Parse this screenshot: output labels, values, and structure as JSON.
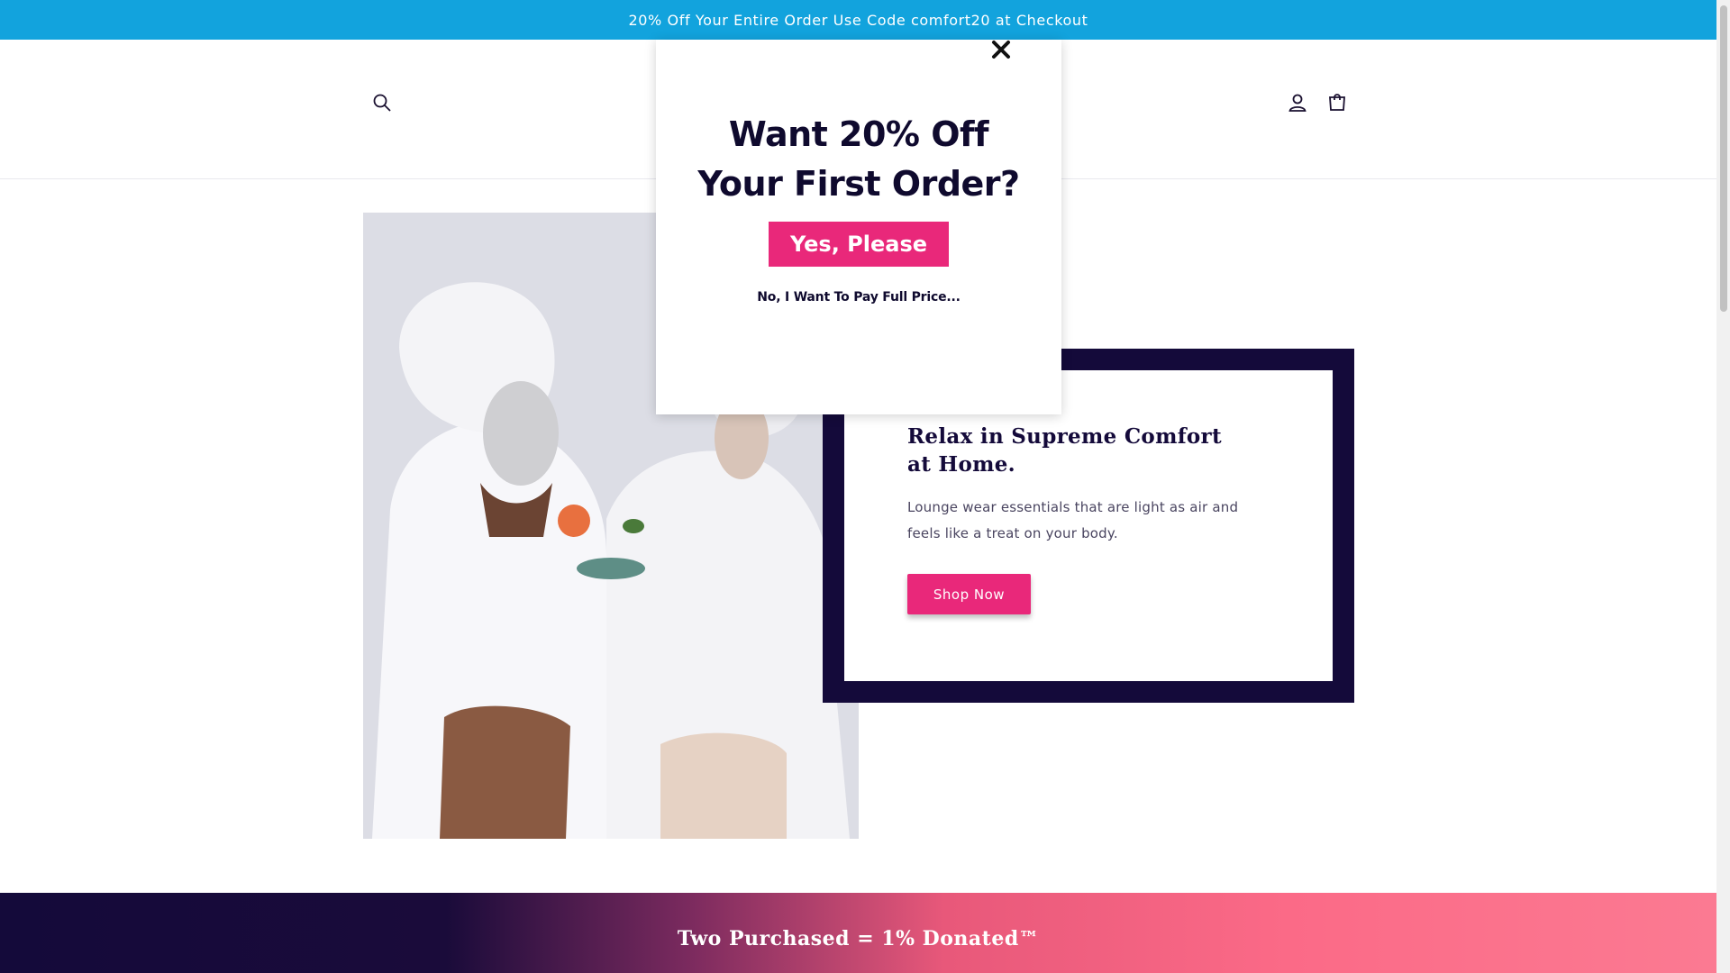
{
  "announcement": {
    "text": "20% Off Your Entire Order Use Code comfort20 at Checkout"
  },
  "header": {
    "icons": {
      "search": "search-icon",
      "account": "account-icon",
      "cart": "cart-icon"
    }
  },
  "hero": {
    "image": "two-women-in-white-robes-with-face-masks",
    "title": "Relax in Supreme Comfort at Home.",
    "description": "Lounge wear essentials that are light as air and feels like a treat on your body.",
    "button_label": "Shop Now"
  },
  "donate_banner": {
    "text": "Two Purchased = 1% Donated™"
  },
  "popup": {
    "heading_line1": "Want 20% Off",
    "heading_line2": "Your First Order?",
    "yes_label": "Yes, Please",
    "no_label": "No, I Want To Pay Full Price...",
    "close_icon": "close-icon"
  },
  "colors": {
    "announcement_bg": "#12a3dd",
    "brand_navy": "#140a3a",
    "accent_pink": "#e9287a"
  }
}
